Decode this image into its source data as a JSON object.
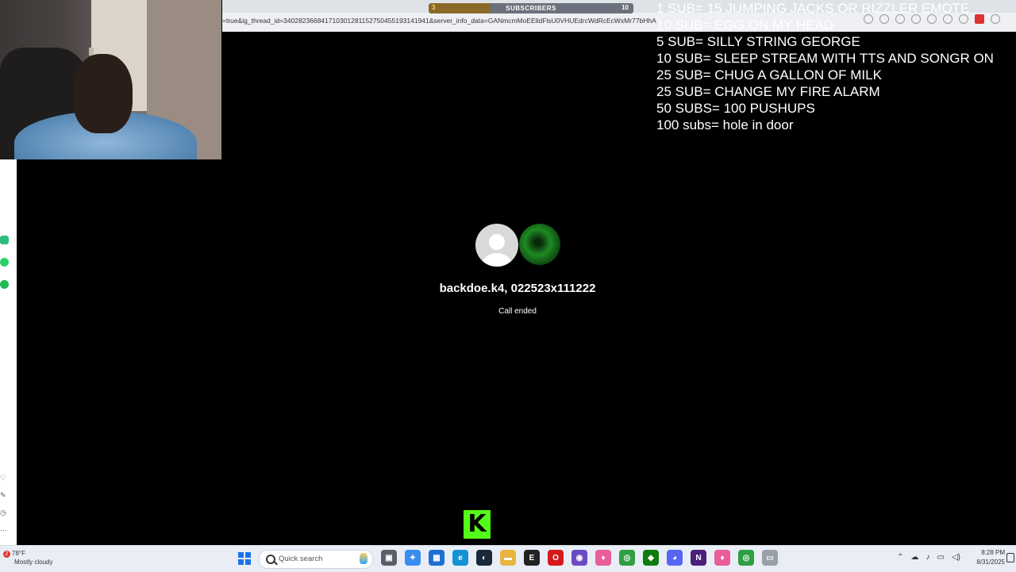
{
  "browser": {
    "url": "=true&ig_thread_id=340282366841710301281152750455193141941&server_info_data=GANmcmMoEElldFlsU0VHUEdrcWdRcEcWxMr77bHhA"
  },
  "sub_goal_bar": {
    "start": "3",
    "label": "SUBSCRIBERS",
    "end": "10",
    "progress": 0.3
  },
  "goals": [
    "1 SUB= 15 JUMPING JACKS OR RIZZLER EMOTE",
    "10 SUB= EGG ON MY HEAD",
    "5 SUB= SILLY STRING GEORGE",
    "10 SUB= SLEEP STREAM WITH TTS AND SONGR ON",
    "25 SUB= CHUG A GALLON OF MILK",
    "25 SUB= CHANGE MY FIRE ALARM",
    "50 SUBS= 100 PUSHUPS",
    "100 subs= hole in door"
  ],
  "call": {
    "participants": "backdoe.k4, 022523x111222",
    "status": "Call ended"
  },
  "taskbar": {
    "weather_badge": "2",
    "temperature": "78°F",
    "condition": "Mostly cloudy",
    "search_placeholder": "Quick search",
    "time": "8:28 PM",
    "date": "8/31/2025",
    "apps": [
      {
        "name": "file-explorer-icon",
        "color": "#5a5f66",
        "glyph": "▣"
      },
      {
        "name": "copilot-icon",
        "color": "#3a8df0",
        "glyph": "✦"
      },
      {
        "name": "store-icon",
        "color": "#1f6fd1",
        "glyph": "▦"
      },
      {
        "name": "edge-icon",
        "color": "#1592d6",
        "glyph": "e"
      },
      {
        "name": "steam-icon",
        "color": "#1b2838",
        "glyph": "◐"
      },
      {
        "name": "folder-icon",
        "color": "#e8b640",
        "glyph": "▬"
      },
      {
        "name": "epic-games-icon",
        "color": "#222",
        "glyph": "E"
      },
      {
        "name": "opera-icon",
        "color": "#d41a1a",
        "glyph": "O"
      },
      {
        "name": "app-purple-icon",
        "color": "#6a4bc4",
        "glyph": "◉"
      },
      {
        "name": "maps-pin-icon",
        "color": "#e85d9a",
        "glyph": "♦"
      },
      {
        "name": "chrome-icon",
        "color": "#2f9e44",
        "glyph": "◎"
      },
      {
        "name": "xbox-app-icon",
        "color": "#0f7b0f",
        "glyph": "◆"
      },
      {
        "name": "discord-icon",
        "color": "#5865f2",
        "glyph": "◕"
      },
      {
        "name": "next-app-icon",
        "color": "#4b1f7a",
        "glyph": "N"
      },
      {
        "name": "maps-pin-icon-2",
        "color": "#e85d9a",
        "glyph": "♦"
      },
      {
        "name": "chrome-profile-icon",
        "color": "#2f9e44",
        "glyph": "◎"
      },
      {
        "name": "app-gray-icon",
        "color": "#9aa0a8",
        "glyph": "▭"
      }
    ]
  }
}
